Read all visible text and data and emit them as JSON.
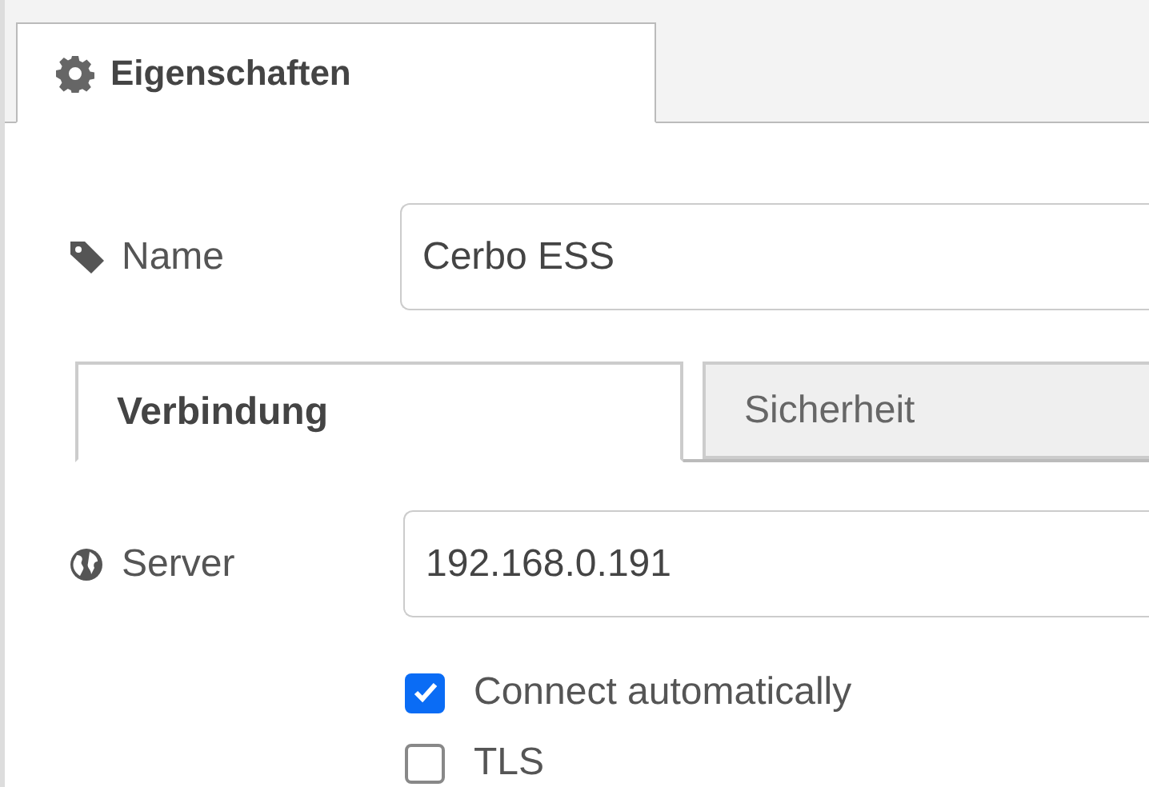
{
  "top_tabs": [
    {
      "label": "Eigenschaften",
      "selected": true
    }
  ],
  "name_field": {
    "label": "Name",
    "value": "Cerbo ESS"
  },
  "sub_tabs": [
    {
      "label": "Verbindung",
      "selected": true
    },
    {
      "label": "Sicherheit",
      "selected": false
    }
  ],
  "server_field": {
    "label": "Server",
    "value": "192.168.0.191"
  },
  "options": [
    {
      "label": "Connect automatically",
      "checked": true
    },
    {
      "label": "TLS",
      "checked": false
    }
  ]
}
